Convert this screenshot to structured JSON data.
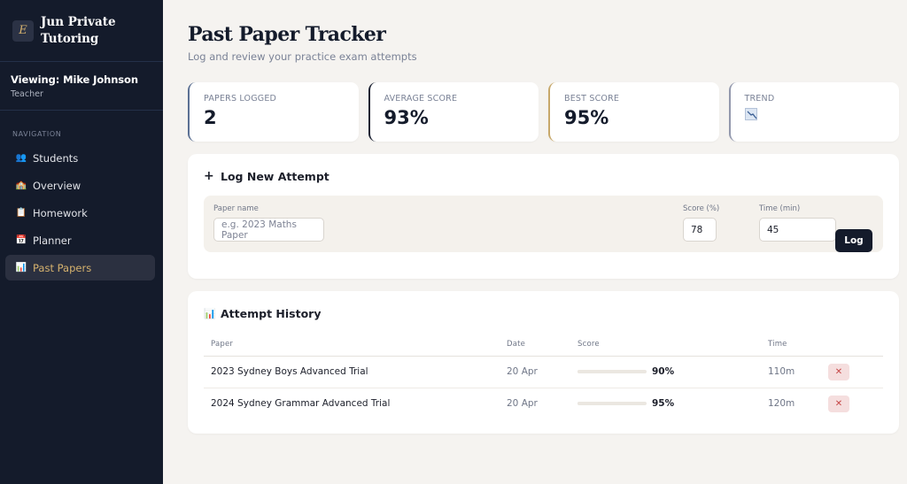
{
  "brand": {
    "logo_letter": "E",
    "name": "Jun Private Tutoring"
  },
  "viewer": {
    "name": "Viewing: Mike Johnson",
    "role": "Teacher"
  },
  "nav": {
    "heading": "NAVIGATION",
    "items": [
      {
        "label": "Students",
        "icon": "people-icon",
        "glyph": "👥",
        "active": false
      },
      {
        "label": "Overview",
        "icon": "house-icon",
        "glyph": "🏫",
        "active": false
      },
      {
        "label": "Homework",
        "icon": "clipboard-icon",
        "glyph": "📋",
        "active": false
      },
      {
        "label": "Planner",
        "icon": "calendar-icon",
        "glyph": "📅",
        "active": false
      },
      {
        "label": "Past Papers",
        "icon": "bar-chart-icon",
        "glyph": "📊",
        "active": true
      }
    ]
  },
  "page": {
    "title": "Past Paper Tracker",
    "subtitle": "Log and review your practice exam attempts"
  },
  "stats": [
    {
      "label": "PAPERS LOGGED",
      "value": "2"
    },
    {
      "label": "AVERAGE SCORE",
      "value": "93%"
    },
    {
      "label": "BEST SCORE",
      "value": "95%"
    },
    {
      "label": "TREND",
      "icon": "trend-down-icon"
    }
  ],
  "log_form": {
    "title": "Log New Attempt",
    "title_glyph": "+",
    "paper_label": "Paper name",
    "paper_placeholder": "e.g. 2023 Maths Paper",
    "score_label": "Score (%)",
    "score_value": "78",
    "time_label": "Time (min)",
    "time_value": "45",
    "button_label": "Log"
  },
  "history": {
    "title": "Attempt History",
    "title_glyph": "📊",
    "columns": [
      "Paper",
      "Date",
      "Score",
      "Time"
    ],
    "rows": [
      {
        "paper": "2023 Sydney Boys Advanced Trial",
        "date": "20 Apr",
        "score": 90,
        "score_label": "90%",
        "time": "110m"
      },
      {
        "paper": "2024 Sydney Grammar Advanced Trial",
        "date": "20 Apr",
        "score": 95,
        "score_label": "95%",
        "time": "120m"
      }
    ],
    "delete_glyph": "✕"
  },
  "colors": {
    "sidebar_bg": "#141b2b",
    "accent_gold": "#d6b26e",
    "page_bg": "#f5f3f0",
    "delete_red": "#c54646"
  }
}
